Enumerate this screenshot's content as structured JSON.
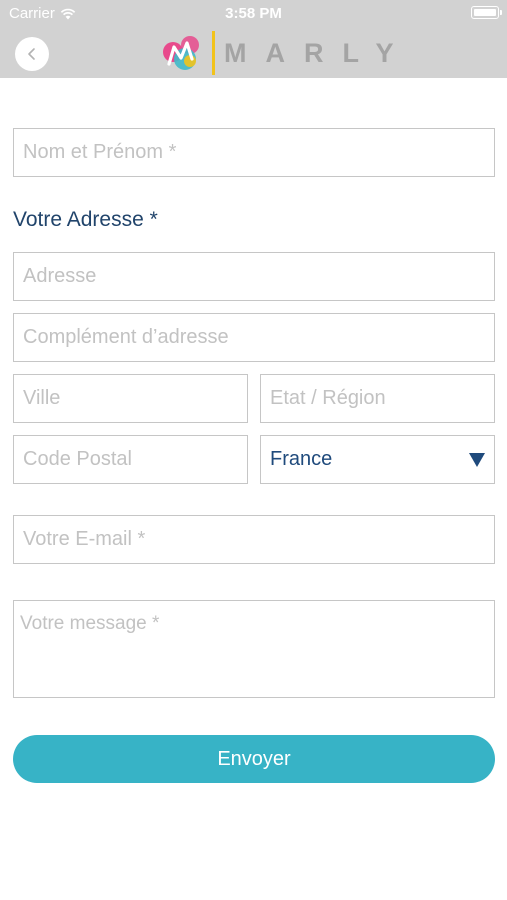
{
  "status_bar": {
    "carrier": "Carrier",
    "time": "3:58 PM",
    "icons": [
      "wifi-icon",
      "battery-icon"
    ]
  },
  "header": {
    "brand": "MARLY",
    "back_icon": "chevron-left-icon",
    "colors": {
      "bar": "#d2d2d2",
      "divider": "#f2c31b",
      "brand_text": "#a4a4a4"
    }
  },
  "form": {
    "name_placeholder": "Nom et Prénom *",
    "address_title": "Votre Adresse *",
    "address_placeholder": "Adresse",
    "address2_placeholder": "Complément d’adresse",
    "city_placeholder": "Ville",
    "region_placeholder": "Etat / Région",
    "postal_placeholder": "Code Postal",
    "country_value": "France",
    "email_placeholder": "Votre E-mail *",
    "message_placeholder": "Votre message *",
    "submit_label": "Envoyer"
  },
  "colors": {
    "accent": "#37b3c6",
    "title": "#21446b",
    "select_text": "#1f4a7c",
    "border": "#c6c6c6",
    "placeholder": "#c2c2c2"
  }
}
